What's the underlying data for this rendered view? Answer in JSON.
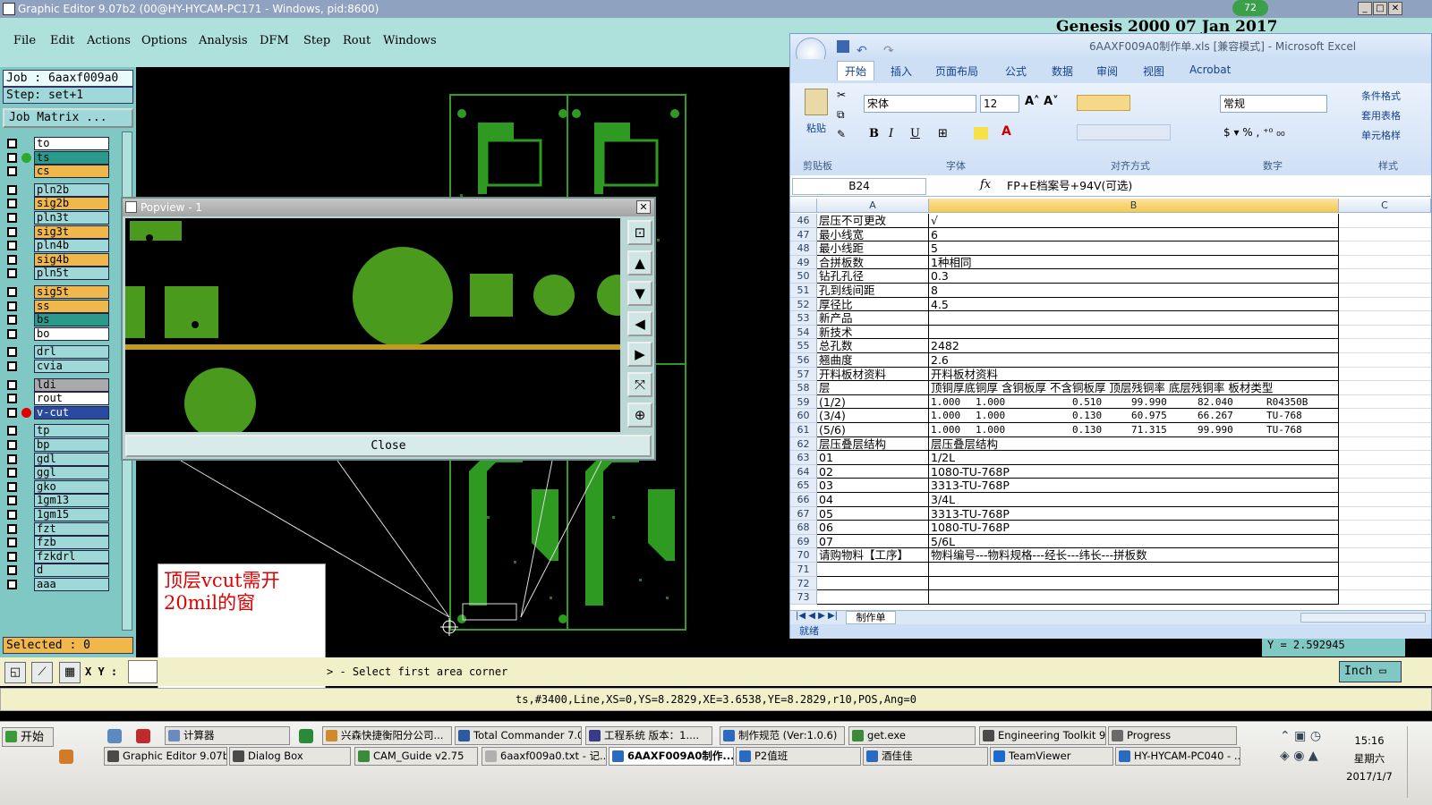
{
  "ge_window": {
    "title": "Graphic Editor 9.07b2 (00@HY-HYCAM-PC171 - Windows, pid:8600)",
    "genesis_header": "Genesis 2000 07 Jan 2017",
    "badge": "72",
    "menu": [
      "File",
      "Edit",
      "Actions",
      "Options",
      "Analysis",
      "DFM",
      "Step",
      "Rout",
      "Windows"
    ],
    "job_label": "Job : 6aaxf009a0",
    "step_label": "Step: set+1",
    "job_matrix_label": "Job Matrix ...",
    "layers": [
      {
        "name": "to",
        "color": "#ffffff"
      },
      {
        "name": "ts",
        "color": "#2a9a8a"
      },
      {
        "name": "cs",
        "color": "#f0b84a"
      },
      {
        "name": "pln2b",
        "color": "#9fd8d8"
      },
      {
        "name": "sig2b",
        "color": "#f0b84a"
      },
      {
        "name": "pln3t",
        "color": "#9fd8d8"
      },
      {
        "name": "sig3t",
        "color": "#f0b84a"
      },
      {
        "name": "pln4b",
        "color": "#9fd8d8"
      },
      {
        "name": "sig4b",
        "color": "#f0b84a"
      },
      {
        "name": "pln5t",
        "color": "#9fd8d8"
      },
      {
        "name": "sig5t",
        "color": "#f0b84a"
      },
      {
        "name": "ss",
        "color": "#f0b84a"
      },
      {
        "name": "bs",
        "color": "#2a9a8a"
      },
      {
        "name": "bo",
        "color": "#ffffff"
      },
      {
        "name": "drl",
        "color": "#9fd8d8"
      },
      {
        "name": "cvia",
        "color": "#9fd8d8"
      },
      {
        "name": "ldi",
        "color": "#aaaaaa"
      },
      {
        "name": "rout",
        "color": "#ffffff"
      },
      {
        "name": "v-cut",
        "color": "#2a4aa0"
      },
      {
        "name": "tp",
        "color": "#9fd8d8"
      },
      {
        "name": "bp",
        "color": "#9fd8d8"
      },
      {
        "name": "gdl",
        "color": "#9fd8d8"
      },
      {
        "name": "ggl",
        "color": "#9fd8d8"
      },
      {
        "name": "gko",
        "color": "#9fd8d8"
      },
      {
        "name": "1gm13",
        "color": "#9fd8d8"
      },
      {
        "name": "1gm15",
        "color": "#9fd8d8"
      },
      {
        "name": "fzt",
        "color": "#9fd8d8"
      },
      {
        "name": "fzb",
        "color": "#9fd8d8"
      },
      {
        "name": "fzkdrl",
        "color": "#9fd8d8"
      },
      {
        "name": "d",
        "color": "#9fd8d8"
      },
      {
        "name": "aaa",
        "color": "#9fd8d8"
      }
    ],
    "selected_label": "Selected : 0",
    "xy_label": "X Y :",
    "prompt": "> - Select first area corner",
    "status_line": "ts,#3400,Line,XS=0,YS=8.2829,XE=3.6538,YE=8.2829,r10,POS,Ang=0",
    "y_readout": "Y = 2.592945",
    "unit_button": "Inch",
    "annotation": "顶层vcut需开20mil的窗"
  },
  "popview": {
    "title": "Popview - 1",
    "close_label": "Close"
  },
  "excel": {
    "title": "6AAXF009A0制作单.xls [兼容模式] - Microsoft Excel",
    "tabs": [
      "开始",
      "插入",
      "页面布局",
      "公式",
      "数据",
      "审阅",
      "视图",
      "Acrobat"
    ],
    "font_name": "宋体",
    "font_size": "12",
    "number_format": "常规",
    "groups": [
      "剪贴板",
      "字体",
      "对齐方式",
      "数字",
      "样式"
    ],
    "paste_label": "粘贴",
    "styles_items": [
      "条件格式",
      "套用表格",
      "单元格样"
    ],
    "cell_ref": "B24",
    "formula": "FP+E档案号+94V(可选)",
    "columns": [
      "A",
      "B",
      "C"
    ],
    "rows": [
      {
        "n": "46",
        "a": "层压不可更改",
        "b": "√"
      },
      {
        "n": "47",
        "a": "最小线宽",
        "b": "6"
      },
      {
        "n": "48",
        "a": "最小线距",
        "b": "5"
      },
      {
        "n": "49",
        "a": "合拼板数",
        "b": "1种相同"
      },
      {
        "n": "50",
        "a": "钻孔孔径",
        "b": "0.3"
      },
      {
        "n": "51",
        "a": "孔到线间距",
        "b": "8"
      },
      {
        "n": "52",
        "a": "厚径比",
        "b": "4.5"
      },
      {
        "n": "53",
        "a": "新产品",
        "b": ""
      },
      {
        "n": "54",
        "a": "新技术",
        "b": ""
      },
      {
        "n": "55",
        "a": "总孔数",
        "b": "2482"
      },
      {
        "n": "56",
        "a": "翘曲度",
        "b": "2.6"
      },
      {
        "n": "57",
        "a": "开料板材资料",
        "b": "开料板材资料"
      },
      {
        "n": "58",
        "a": "层",
        "b": "顶铜厚底铜厚 含铜板厚 不含铜板厚 顶层残铜率 底层残铜率 板材类型"
      },
      {
        "n": "59",
        "a": "(1/2)",
        "b": "",
        "sub": [
          "1.000",
          "1.000",
          "0.510",
          "99.990",
          "82.040",
          "R04350B"
        ]
      },
      {
        "n": "60",
        "a": "(3/4)",
        "b": "",
        "sub": [
          "1.000",
          "1.000",
          "0.130",
          "60.975",
          "66.267",
          "TU-768"
        ]
      },
      {
        "n": "61",
        "a": "(5/6)",
        "b": "",
        "sub": [
          "1.000",
          "1.000",
          "0.130",
          "71.315",
          "99.990",
          "TU-768"
        ]
      },
      {
        "n": "62",
        "a": "层压叠层结构",
        "b": "层压叠层结构"
      },
      {
        "n": "63",
        "a": "01",
        "b": "1/2L"
      },
      {
        "n": "64",
        "a": "02",
        "b": "1080-TU-768P"
      },
      {
        "n": "65",
        "a": "03",
        "b": "3313-TU-768P"
      },
      {
        "n": "66",
        "a": "04",
        "b": "3/4L"
      },
      {
        "n": "67",
        "a": "05",
        "b": "3313-TU-768P"
      },
      {
        "n": "68",
        "a": "06",
        "b": "1080-TU-768P"
      },
      {
        "n": "69",
        "a": "07",
        "b": "5/6L"
      },
      {
        "n": "70",
        "a": "请购物料【工序】",
        "b": "物料编号---物料规格---经长---纬长---拼板数"
      },
      {
        "n": "71",
        "a": "",
        "b": ""
      },
      {
        "n": "72",
        "a": "",
        "b": ""
      },
      {
        "n": "73",
        "a": "",
        "b": ""
      }
    ],
    "sheet_tab": "制作单",
    "status": "就绪"
  },
  "taskbar": {
    "start": "开始",
    "row1": [
      "计算器",
      "兴森快捷衡阳分公司...",
      "Total Commander 7.0 ...",
      "工程系统  版本：1....",
      "制作规范 (Ver:1.0.6)",
      "get.exe",
      "Engineering Toolkit 9....",
      "Progress"
    ],
    "row2": [
      "Graphic Editor 9.07b...",
      "Dialog Box",
      "CAM_Guide v2.75",
      "6aaxf009a0.txt - 记...",
      "6AAXF009A0制作...",
      "P2值班",
      "酒佳佳",
      "TeamViewer",
      "HY-HYCAM-PC040 - ..."
    ],
    "clock_time": "15:16",
    "clock_day": "星期六",
    "clock_date": "2017/1/7"
  }
}
